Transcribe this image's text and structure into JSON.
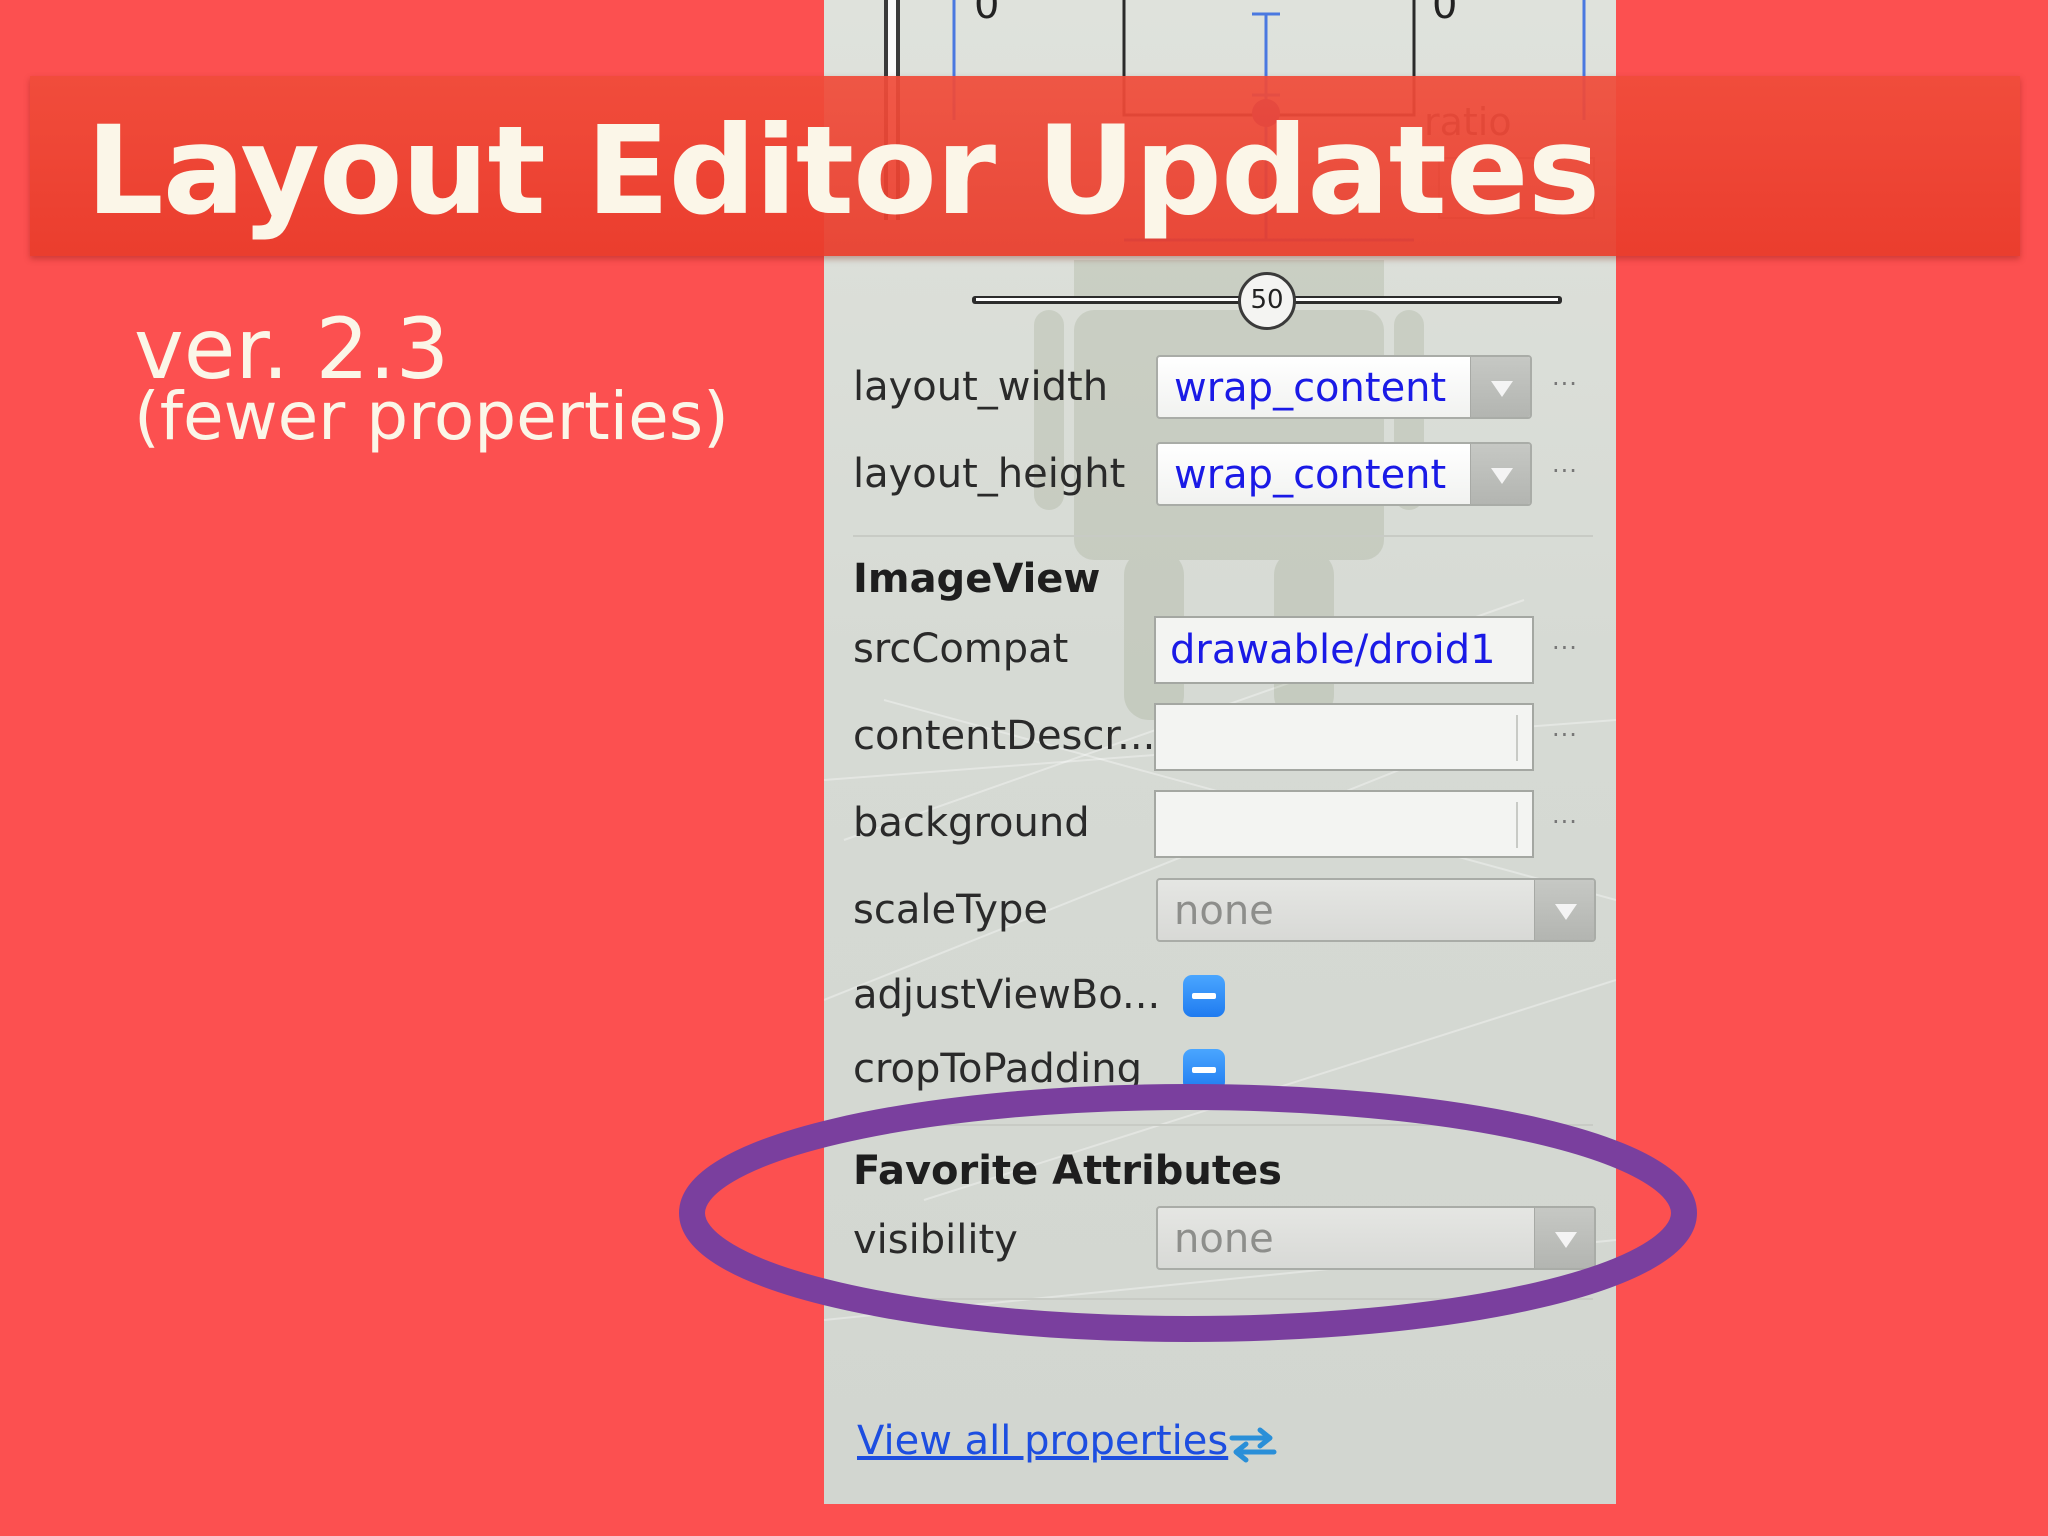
{
  "slide": {
    "title": "Layout Editor Updates",
    "version": "ver. 2.3",
    "subtitle": "(fewer properties)",
    "background_color": "#fc5050",
    "highlight_color": "#7a3f9e"
  },
  "constraint_widget": {
    "left_margin": "0",
    "right_margin": "0",
    "ratio_label": "ratio",
    "ratio_value": "",
    "bias_value": "50"
  },
  "layout_props": [
    {
      "label": "layout_width",
      "value": "wrap_content",
      "ellipsis": "···"
    },
    {
      "label": "layout_height",
      "value": "wrap_content",
      "ellipsis": "···"
    }
  ],
  "imageview": {
    "section_title": "ImageView",
    "src_compat": {
      "label": "srcCompat",
      "value": "drawable/droid1",
      "ellipsis": "···"
    },
    "content_description": {
      "label": "contentDescr...",
      "value": "",
      "ellipsis": "···"
    },
    "background": {
      "label": "background",
      "value": "",
      "ellipsis": "···"
    },
    "scale_type": {
      "label": "scaleType",
      "value": "none"
    },
    "adjust_view_bounds": {
      "label": "adjustViewBo...",
      "state": "indeterminate"
    },
    "crop_to_padding": {
      "label": "cropToPadding",
      "state": "indeterminate"
    }
  },
  "favorites": {
    "section_title": "Favorite Attributes",
    "visibility": {
      "label": "visibility",
      "value": "none"
    }
  },
  "footer": {
    "view_all_link": "View all properties",
    "link_icon": "swap-arrows-icon"
  }
}
